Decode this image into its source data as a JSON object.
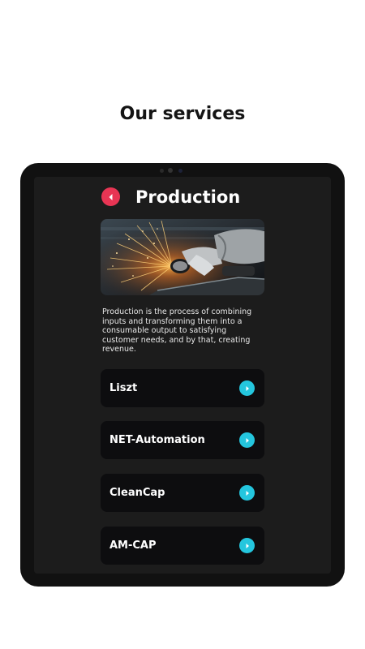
{
  "page": {
    "heading": "Our services"
  },
  "screen": {
    "title": "Production",
    "back_icon": "chevron-left-icon",
    "hero_image": "metal-grinding-sparks-photo",
    "description": "Production is the process of combining inputs and transforming them into a consumable output to satisfying customer needs, and by that, creating revenue."
  },
  "services": [
    {
      "label": "Liszt",
      "icon": "chevron-right-icon"
    },
    {
      "label": "NET-Automation",
      "icon": "chevron-right-icon"
    },
    {
      "label": "CleanCap",
      "icon": "chevron-right-icon"
    },
    {
      "label": "AM-CAP",
      "icon": "chevron-right-icon"
    }
  ],
  "colors": {
    "accent_back": "#e83554",
    "accent_arrow": "#24c6de",
    "device": "#111111",
    "screen_bg": "#1c1c1c",
    "button_bg": "#0d0d0f"
  }
}
